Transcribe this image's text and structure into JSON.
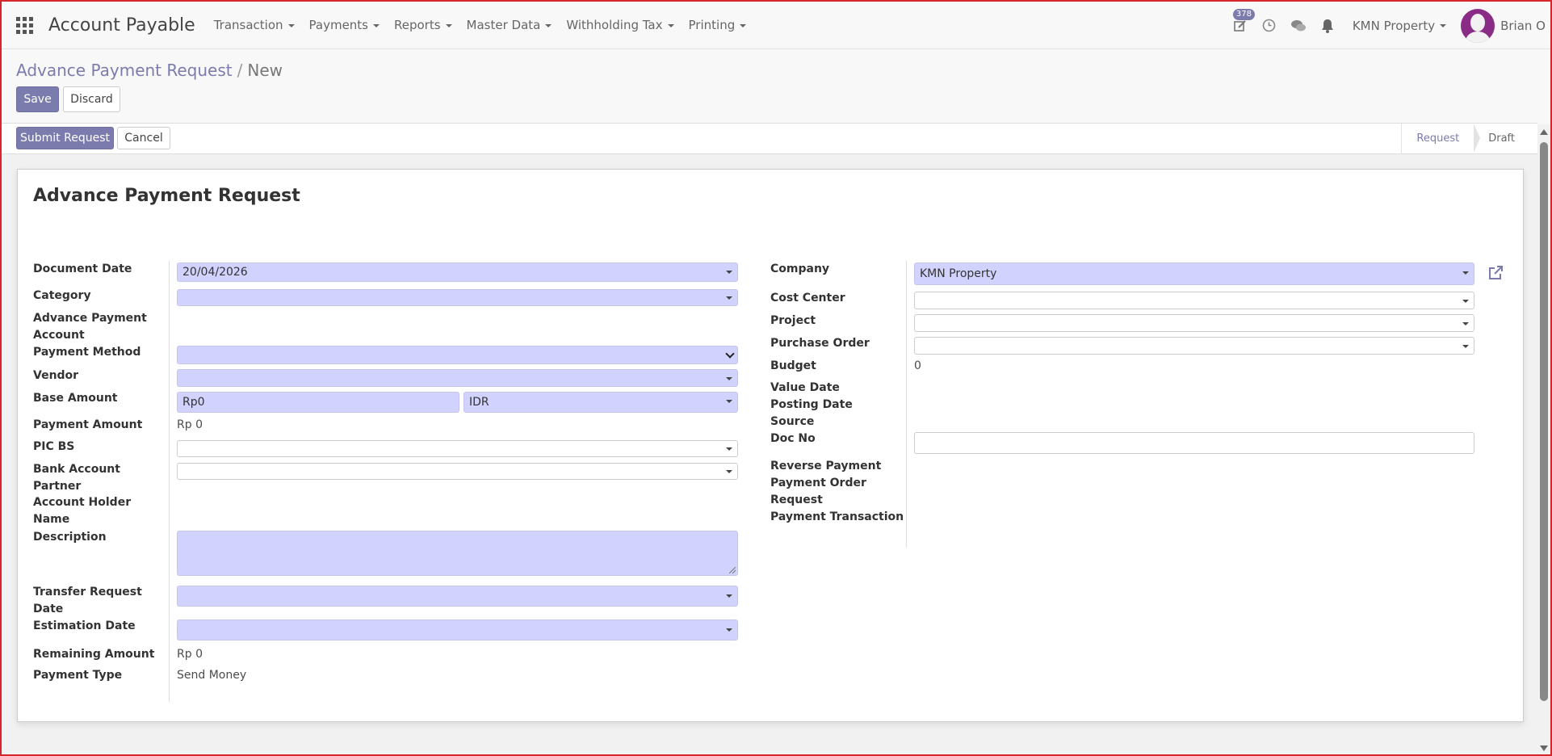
{
  "app": {
    "title": "Account Payable"
  },
  "menu": {
    "items": [
      {
        "label": "Transaction"
      },
      {
        "label": "Payments"
      },
      {
        "label": "Reports"
      },
      {
        "label": "Master Data"
      },
      {
        "label": "Withholding Tax"
      },
      {
        "label": "Printing"
      }
    ]
  },
  "systray": {
    "activity_count": "378",
    "company": "KMN Property",
    "user": "Brian O"
  },
  "breadcrumb": {
    "parent": "Advance Payment Request",
    "separator": "/",
    "current": "New"
  },
  "buttons": {
    "save": "Save",
    "discard": "Discard",
    "submit": "Submit Request",
    "cancel": "Cancel"
  },
  "stages": {
    "request": "Request",
    "draft": "Draft"
  },
  "form": {
    "title": "Advance Payment Request",
    "left": {
      "document_date": {
        "label": "Document Date",
        "value": "20/04/2026"
      },
      "category": {
        "label": "Category",
        "value": ""
      },
      "advance_payment_account": {
        "label_1": "Advance Payment",
        "label_2": "Account"
      },
      "payment_method": {
        "label": "Payment Method",
        "value": ""
      },
      "vendor": {
        "label": "Vendor",
        "value": ""
      },
      "base_amount": {
        "label": "Base Amount",
        "value": "Rp0",
        "currency": "IDR"
      },
      "payment_amount": {
        "label": "Payment Amount",
        "value": "Rp 0"
      },
      "pic_bs": {
        "label": "PIC BS",
        "value": ""
      },
      "bank_account_partner": {
        "label_1": "Bank Account",
        "label_2": "Partner",
        "value": ""
      },
      "account_holder_name": {
        "label_1": "Account Holder",
        "label_2": "Name"
      },
      "description": {
        "label": "Description",
        "value": ""
      },
      "transfer_request_date": {
        "label_1": "Transfer Request",
        "label_2": "Date",
        "value": ""
      },
      "estimation_date": {
        "label": "Estimation Date",
        "value": ""
      },
      "remaining_amount": {
        "label": "Remaining Amount",
        "value": "Rp 0"
      },
      "payment_type": {
        "label": "Payment Type",
        "value": "Send Money"
      }
    },
    "right": {
      "company": {
        "label": "Company",
        "value": "KMN Property"
      },
      "cost_center": {
        "label": "Cost Center",
        "value": ""
      },
      "project": {
        "label": "Project",
        "value": ""
      },
      "purchase_order": {
        "label": "Purchase Order",
        "value": ""
      },
      "budget": {
        "label": "Budget",
        "value": "0"
      },
      "value_date": {
        "label": "Value Date"
      },
      "posting_date": {
        "label": "Posting Date"
      },
      "source": {
        "label": "Source"
      },
      "doc_no": {
        "label": "Doc No",
        "value": ""
      },
      "reverse_payment": {
        "label": "Reverse Payment"
      },
      "payment_order_request": {
        "label_1": "Payment Order",
        "label_2": "Request"
      },
      "payment_transaction": {
        "label": "Payment Transaction"
      }
    }
  },
  "colors": {
    "accent": "#7c7bad",
    "required_field": "#d2d2ff",
    "frame": "#d7262b"
  },
  "icons": [
    "apps-icon",
    "edit-icon",
    "clock-icon",
    "chat-icon",
    "bell-icon",
    "external-link-icon"
  ]
}
